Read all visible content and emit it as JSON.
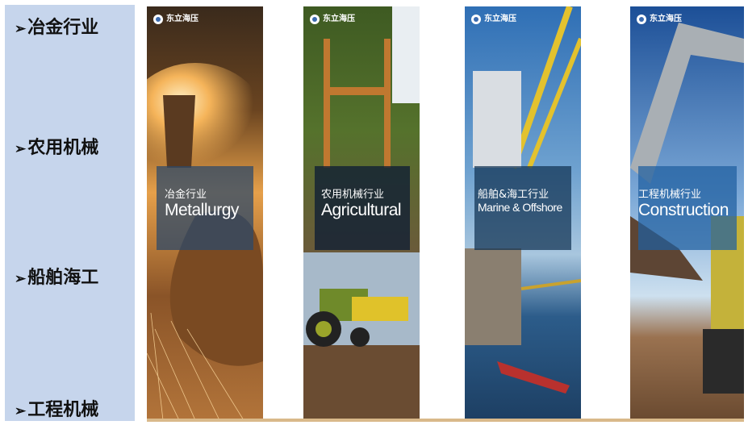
{
  "sidebar": {
    "arrow": "➢",
    "items": [
      {
        "label": "冶金行业"
      },
      {
        "label": "农用机械"
      },
      {
        "label": "船舶海工"
      },
      {
        "label": "工程机械"
      }
    ]
  },
  "panels": [
    {
      "cn": "冶金行业",
      "en": "Metallurgy",
      "logo": "东立海压",
      "theme": "#c8842f"
    },
    {
      "cn": "农用机械行业",
      "en": "Agricultural",
      "logo": "东立海压",
      "theme": "#4f6b2a"
    },
    {
      "cn": "船舶&海工行业",
      "en": "Marine & Offshore",
      "logo": "东立海压",
      "theme": "#3c7bc0"
    },
    {
      "cn": "工程机械行业",
      "en": "Construction",
      "logo": "东立海压",
      "theme": "#2f6aa8"
    }
  ]
}
